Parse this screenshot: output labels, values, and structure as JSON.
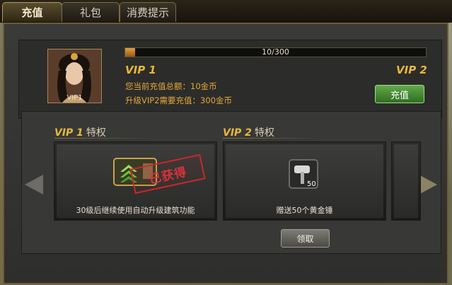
{
  "tabs": [
    {
      "label": "充值",
      "active": true
    },
    {
      "label": "礼包",
      "active": false
    },
    {
      "label": "消费提示",
      "active": false
    }
  ],
  "portrait": {
    "label": "VIP1"
  },
  "progress": {
    "text": "10/300",
    "value": 10,
    "max": 300
  },
  "vip": {
    "current": "VIP 1",
    "next": "VIP 2"
  },
  "info": {
    "total": "您当前充值总额：10金币",
    "need": "升级VIP2需要充值：300金币"
  },
  "recharge_button": "充值",
  "privileges": [
    {
      "vip": "VIP 1",
      "title": "特权",
      "desc": "30级后继续使用自动升级建筑功能",
      "stamp": "已获得",
      "icon": "upgrade-arrows-icon"
    },
    {
      "vip": "VIP 2",
      "title": "特权",
      "desc": "赠送50个黄金锤",
      "badge": "50",
      "icon": "gold-hammer-icon"
    }
  ],
  "claim_button": "领取",
  "colors": {
    "accent": "#e8b838",
    "green": "#3f8a2e",
    "stamp": "#c8282a"
  }
}
